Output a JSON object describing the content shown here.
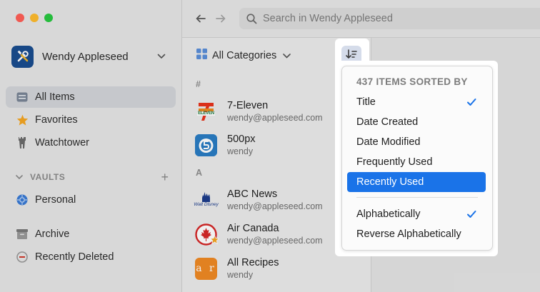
{
  "search": {
    "placeholder": "Search in Wendy Appleseed"
  },
  "account": {
    "name": "Wendy Appleseed"
  },
  "sidebar": {
    "items": [
      {
        "label": "All Items"
      },
      {
        "label": "Favorites"
      },
      {
        "label": "Watchtower"
      }
    ],
    "vaults_header": "VAULTS",
    "vaults": [
      {
        "label": "Personal"
      }
    ],
    "bottom": [
      {
        "label": "Archive"
      },
      {
        "label": "Recently Deleted"
      }
    ]
  },
  "list": {
    "category": "All Categories",
    "sections": [
      {
        "letter": "#"
      },
      {
        "letter": "A"
      }
    ],
    "items": [
      {
        "title": "7-Eleven",
        "subtitle": "wendy@appleseed.com",
        "icon_text": "ELEVEN"
      },
      {
        "title": "500px",
        "subtitle": "wendy"
      },
      {
        "title": "ABC News",
        "subtitle": "wendy@appleseed.com",
        "icon_text": "Walt Disney"
      },
      {
        "title": "Air Canada",
        "subtitle": "wendy@appleseed.com"
      },
      {
        "title": "All Recipes",
        "subtitle": "wendy",
        "icon_text": "a r"
      }
    ]
  },
  "sort_menu": {
    "header": "437 ITEMS SORTED BY",
    "fields": [
      {
        "label": "Title",
        "checked": true
      },
      {
        "label": "Date Created"
      },
      {
        "label": "Date Modified"
      },
      {
        "label": "Frequently Used"
      },
      {
        "label": "Recently Used",
        "selected": true
      }
    ],
    "orders": [
      {
        "label": "Alphabetically",
        "checked": true
      },
      {
        "label": "Reverse Alphabetically"
      }
    ]
  },
  "colors": {
    "accent": "#1a73e8",
    "check": "#1a73e8",
    "close": "#ff5f57",
    "minimize": "#febc2e",
    "zoom": "#28c840"
  },
  "icons": {
    "sidebar": [
      "all-items-icon",
      "star-icon",
      "watchtower-icon",
      "personal-vault-icon",
      "archive-icon",
      "trash-icon"
    ],
    "toolbar": [
      "back-arrow-icon",
      "forward-arrow-icon",
      "search-icon",
      "sort-icon"
    ]
  }
}
